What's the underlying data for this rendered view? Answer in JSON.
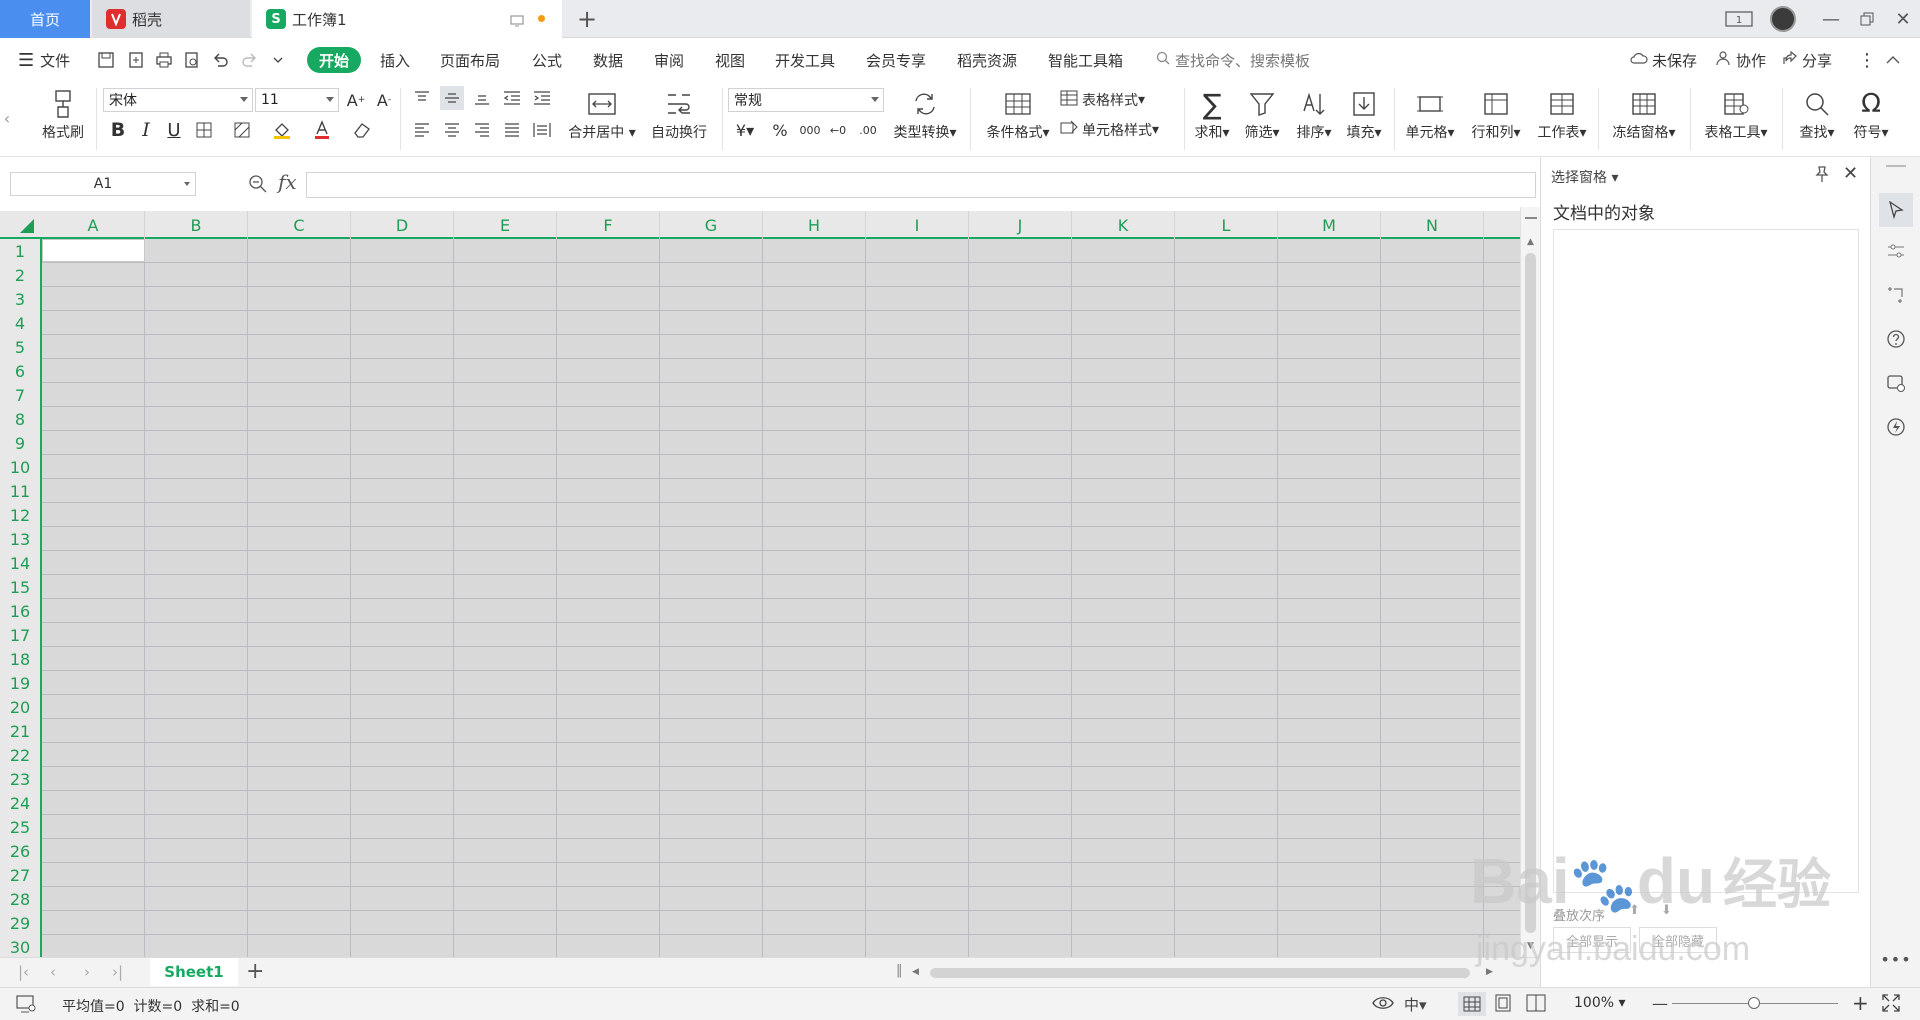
{
  "tabs": {
    "home": "首页",
    "docer": "稻壳",
    "workbook": "工作簿1"
  },
  "menu": {
    "file": "文件",
    "tabs": [
      "开始",
      "插入",
      "页面布局",
      "公式",
      "数据",
      "审阅",
      "视图",
      "开发工具",
      "会员专享",
      "稻壳资源",
      "智能工具箱"
    ],
    "search_placeholder": "查找命令、搜索模板",
    "unsaved": "未保存",
    "collab": "协作",
    "share": "分享"
  },
  "ribbon": {
    "format_painter": "格式刷",
    "font_name": "宋体",
    "font_size": "11",
    "merge_center": "合并居中",
    "auto_wrap": "自动换行",
    "number_format": "常规",
    "type_convert": "类型转换",
    "conditional_format": "条件格式",
    "table_style": "表格样式",
    "cell_style": "单元格样式",
    "sum": "求和",
    "filter": "筛选",
    "sort": "排序",
    "fill": "填充",
    "cell": "单元格",
    "row_col": "行和列",
    "worksheet": "工作表",
    "freeze": "冻结窗格",
    "table_tools": "表格工具",
    "find": "查找",
    "symbol": "符号"
  },
  "formula": {
    "cell_ref": "A1",
    "fx": "fx",
    "value": ""
  },
  "columns": [
    "A",
    "B",
    "C",
    "D",
    "E",
    "F",
    "G",
    "H",
    "I",
    "J",
    "K",
    "L",
    "M",
    "N"
  ],
  "rows": [
    "1",
    "2",
    "3",
    "4",
    "5",
    "6",
    "7",
    "8",
    "9",
    "10",
    "11",
    "12",
    "13",
    "14",
    "15",
    "16",
    "17",
    "18",
    "19",
    "20",
    "21",
    "22",
    "23",
    "24",
    "25",
    "26",
    "27",
    "28",
    "29",
    "30"
  ],
  "sheet": {
    "name": "Sheet1"
  },
  "status": {
    "summary": "平均值=0  计数=0  求和=0",
    "zoom": "100%"
  },
  "pane": {
    "title": "选择窗格",
    "heading": "文档中的对象",
    "order_label": "叠放次序",
    "show_all": "全部显示",
    "hide_all": "全部隐藏"
  },
  "watermark": {
    "brand": "Bai",
    "brand2": "du",
    "cn": "经验",
    "url": "jingyan.baidu.com"
  },
  "colors": {
    "accent": "#17a961",
    "home_tab": "#4a8ef0",
    "grid_fill": "#d9d9d9"
  }
}
